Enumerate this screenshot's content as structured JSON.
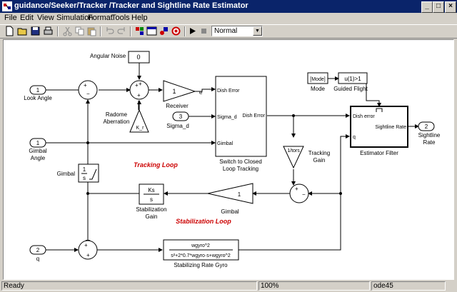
{
  "window": {
    "title": "guidance/Seeker/Tracker /Tracker and Sightline Rate Estimator",
    "controls": {
      "minimize": "_",
      "maximize": "□",
      "close": "×"
    }
  },
  "menu": [
    "File",
    "Edit",
    "View",
    "Simulation",
    "Format",
    "Tools",
    "Help"
  ],
  "toolbar": {
    "icons": [
      "new-file-icon",
      "open-folder-icon",
      "save-icon",
      "print-icon",
      "cut-icon",
      "copy-icon",
      "paste-icon",
      "undo-icon",
      "redo-icon",
      "library-browser-icon",
      "model-browser-icon",
      "debugger-icon",
      "explorer-icon",
      "start-icon",
      "stop-icon"
    ],
    "sim_mode": "Normal"
  },
  "diagram": {
    "angular_noise": {
      "label": "Angular Noise",
      "value": "0"
    },
    "look_angle": {
      "port": "1",
      "label": "Look Angle"
    },
    "receiver": {
      "value": "1",
      "label": "Receiver",
      "out_label": "e"
    },
    "radome": {
      "value": "K_r",
      "label1": "Radome",
      "label2": "Aberration"
    },
    "sigma_d": {
      "port": "3",
      "label": "Sigma_d"
    },
    "gimbal_angle": {
      "port": "1",
      "label1": "Gimbal",
      "label2": "Angle"
    },
    "gimbal_int": {
      "label": "Gimbal",
      "num": "1",
      "den": "s"
    },
    "switch": {
      "in1": "Dish Error",
      "in2": "Sigma_d",
      "in3": "Gimbal",
      "out": "Dish Error",
      "label1": "Switch to Closed",
      "label2": "Loop Tracking"
    },
    "mode": {
      "label": "Mode",
      "value": "[Mode]"
    },
    "guided_flight": {
      "label": "Guided Flight",
      "value": "u(1)>1"
    },
    "estimator": {
      "in1": "Dish error",
      "in2": "q",
      "out": "Sightline Rate",
      "label": "Estimator Filter"
    },
    "sightline_rate": {
      "port": "2",
      "label1": "Sightline",
      "label2": "Rate"
    },
    "tracking_gain": {
      "value": "1/tors",
      "label1": "Tracking",
      "label2": "Gain"
    },
    "tracking_loop": "Tracking Loop",
    "stabilization_gain": {
      "num": "Ks",
      "den": "s",
      "label1": "Stabilization",
      "label2": "Gain"
    },
    "gimbal_gain": {
      "value": "1",
      "label": "Gimbal"
    },
    "stabilization_loop": "Stabilization Loop",
    "q_in": {
      "port": "2",
      "label": "q"
    },
    "rate_gyro": {
      "num": "wgyro^2",
      "den": "s²+2*0.7*wgyro·s+wgyro^2",
      "label": "Stabilizing Rate Gyro"
    }
  },
  "status": {
    "left": "Ready",
    "zoom": "100%",
    "solver": "ode45"
  },
  "colors": {
    "titlebar": "#0a246a",
    "chrome": "#d4d0c8",
    "annotation": "#cc0000"
  }
}
